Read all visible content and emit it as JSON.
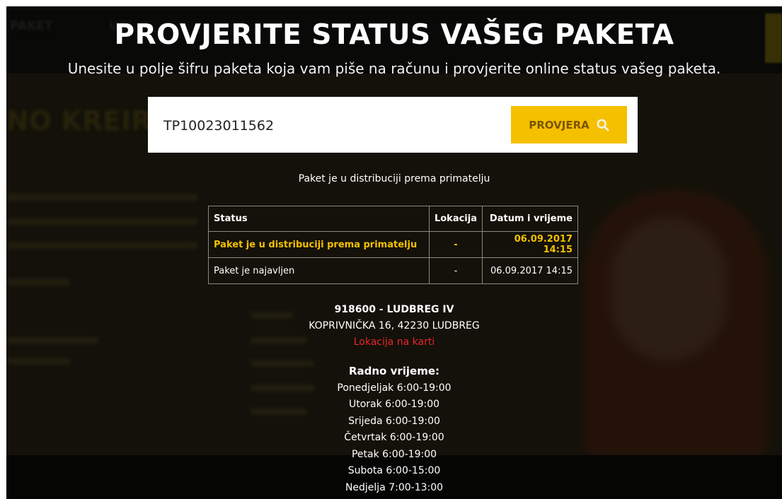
{
  "hero": {
    "title": "PROVJERITE STATUS VAŠEG PAKETA",
    "subtitle": "Unesite u polje šifru paketa koja vam piše na računu i provjerite online status vašeg paketa."
  },
  "search": {
    "value": "TP10023011562",
    "button_label": "PROVJERA",
    "button_icon": "search-icon"
  },
  "result": {
    "status_message": "Paket je u distribuciji prema primatelju",
    "columns": [
      "Status",
      "Lokacija",
      "Datum i vrijeme"
    ],
    "rows": [
      {
        "status": "Paket je u distribuciji prema primatelju",
        "location": "-",
        "datetime": "06.09.2017 14:15"
      },
      {
        "status": "Paket je najavljen",
        "location": "-",
        "datetime": "06.09.2017 14:15"
      }
    ]
  },
  "office": {
    "name": "918600 - LUDBREG IV",
    "address": "KOPRIVNIČKA 16, 42230 LUDBREG",
    "map_link": "Lokacija na karti"
  },
  "hours": {
    "title": "Radno vrijeme:",
    "days": [
      "Ponedjeljak 6:00-19:00",
      "Utorak 6:00-19:00",
      "Srijeda 6:00-19:00",
      "Četvrtak 6:00-19:00",
      "Petak 6:00-19:00",
      "Subota 6:00-15:00",
      "Nedjelja 7:00-13:00"
    ]
  },
  "colors": {
    "accent": "#f5c000",
    "highlight_text": "#f5c000",
    "link_red": "#e8262b"
  }
}
